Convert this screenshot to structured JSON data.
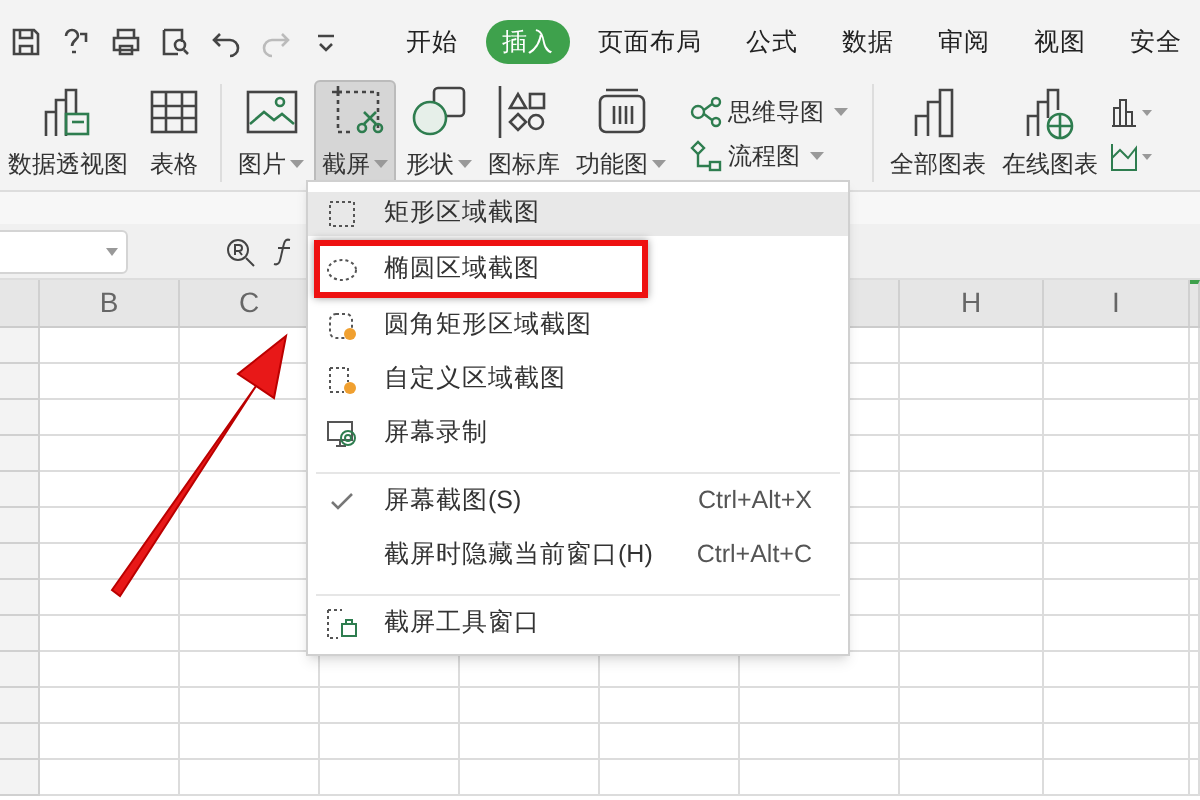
{
  "menu_tabs": [
    {
      "label": "开始",
      "selected": false
    },
    {
      "label": "插入",
      "selected": true
    },
    {
      "label": "页面布局",
      "selected": false
    },
    {
      "label": "公式",
      "selected": false
    },
    {
      "label": "数据",
      "selected": false
    },
    {
      "label": "审阅",
      "selected": false
    },
    {
      "label": "视图",
      "selected": false
    },
    {
      "label": "安全",
      "selected": false
    }
  ],
  "ribbon": [
    {
      "kind": "pivot",
      "label": "数据透视图",
      "dropdown": false,
      "pressed": false
    },
    {
      "kind": "table",
      "label": "表格",
      "dropdown": false,
      "pressed": false
    },
    {
      "kind": "separator"
    },
    {
      "kind": "picture",
      "label": "图片",
      "dropdown": true,
      "pressed": false
    },
    {
      "kind": "screenshot",
      "label": "截屏",
      "dropdown": true,
      "pressed": true
    },
    {
      "kind": "shape",
      "label": "形状",
      "dropdown": true,
      "pressed": false
    },
    {
      "kind": "iconlib",
      "label": "图标库",
      "dropdown": false,
      "pressed": false
    },
    {
      "kind": "function",
      "label": "功能图",
      "dropdown": true,
      "pressed": false
    },
    {
      "kind": "stack",
      "items": [
        {
          "label": "思维导图",
          "dropdown": true
        },
        {
          "label": "流程图",
          "dropdown": true
        }
      ]
    },
    {
      "kind": "separator"
    },
    {
      "kind": "allcharts",
      "label": "全部图表",
      "dropdown": false,
      "pressed": false
    },
    {
      "kind": "online",
      "label": "在线图表",
      "dropdown": false,
      "pressed": false
    }
  ],
  "columns": [
    {
      "label": "B"
    },
    {
      "label": "C"
    },
    {
      "label": "H"
    },
    {
      "label": "I"
    }
  ],
  "menu": {
    "items": [
      {
        "kind": "rect",
        "label": "矩形区域截图",
        "selected": true,
        "highlighted": false
      },
      {
        "kind": "ellipse",
        "label": "椭圆区域截图",
        "selected": false,
        "highlighted": true
      },
      {
        "kind": "rounded",
        "label": "圆角矩形区域截图",
        "selected": false,
        "highlighted": false
      },
      {
        "kind": "custom",
        "label": "自定义区域截图",
        "selected": false,
        "highlighted": false
      },
      {
        "kind": "record",
        "label": "屏幕录制",
        "selected": false,
        "highlighted": false
      },
      {
        "kind": "option",
        "label": "屏幕截图(S)",
        "shortcut": "Ctrl+Alt+X",
        "checked": true,
        "separator_before": true,
        "highlighted": false
      },
      {
        "kind": "option",
        "label": "截屏时隐藏当前窗口(H)",
        "shortcut": "Ctrl+Alt+C",
        "checked": false,
        "highlighted": false
      },
      {
        "kind": "toolwindow",
        "label": "截屏工具窗口",
        "selected": false,
        "separator_before": true,
        "highlighted": false
      }
    ]
  }
}
